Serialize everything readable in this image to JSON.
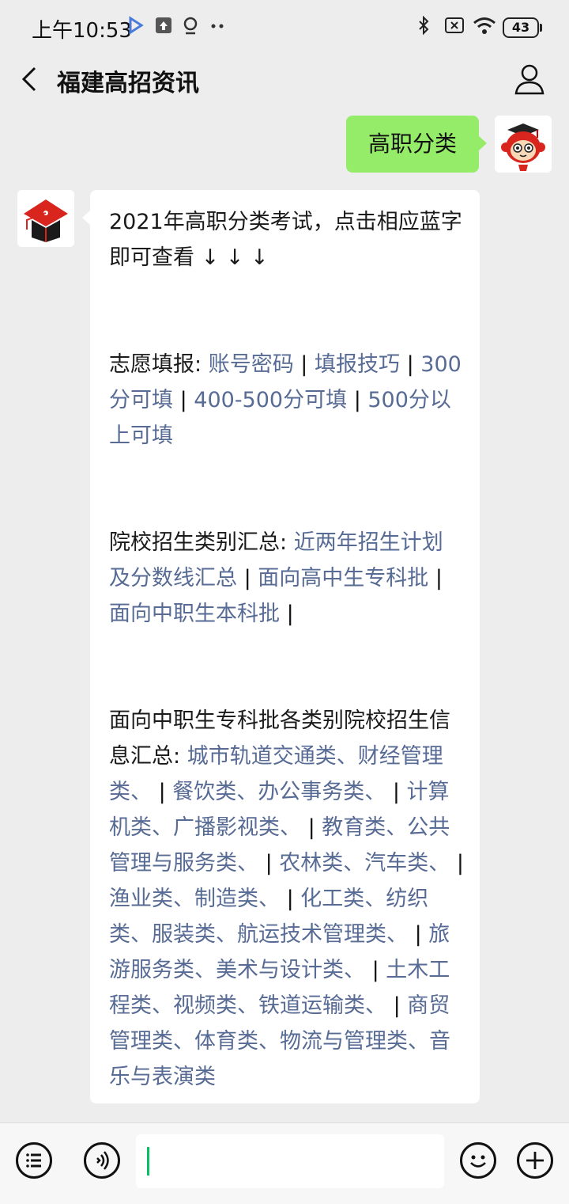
{
  "status": {
    "time": "上午10:53",
    "battery": "43"
  },
  "header": {
    "title": "福建高招资讯"
  },
  "sent": {
    "text": "高职分类"
  },
  "received": {
    "intro": "2021年高职分类考试，点击相应蓝字即可查看 ↓ ↓ ↓",
    "section1": {
      "label": "志愿填报:",
      "links": [
        "账号密码",
        "填报技巧",
        "300分可填",
        "400-500分可填",
        "500分以上可填"
      ]
    },
    "section2": {
      "label": "院校招生类别汇总:",
      "links": [
        "近两年招生计划及分数线汇总",
        "面向高中生专科批",
        "面向中职生本科批"
      ]
    },
    "section3": {
      "label": "面向中职生专科批各类别院校招生信息汇总:",
      "groups": [
        "城市轨道交通类、财经管理类、",
        "餐饮类、办公事务类、",
        "计算机类、广播影视类、",
        "教育类、公共管理与服务类、",
        "农林类、汽车类、",
        "渔业类、制造类、",
        "化工类、纺织类、服装类、航运技术管理类、",
        "旅游服务类、美术与设计类、",
        "土木工程类、视频类、铁道运输类、",
        "商贸管理类、体育类、物流与管理类、音乐与表演类"
      ]
    }
  },
  "colors": {
    "link": "#576b95",
    "sent_bubble": "#95ec69",
    "background": "#ededed"
  },
  "icons": {
    "back": "chevron-left-icon",
    "profile": "person-icon",
    "menu": "list-icon",
    "voice": "voice-icon",
    "emoji": "emoji-icon",
    "plus": "plus-icon"
  }
}
